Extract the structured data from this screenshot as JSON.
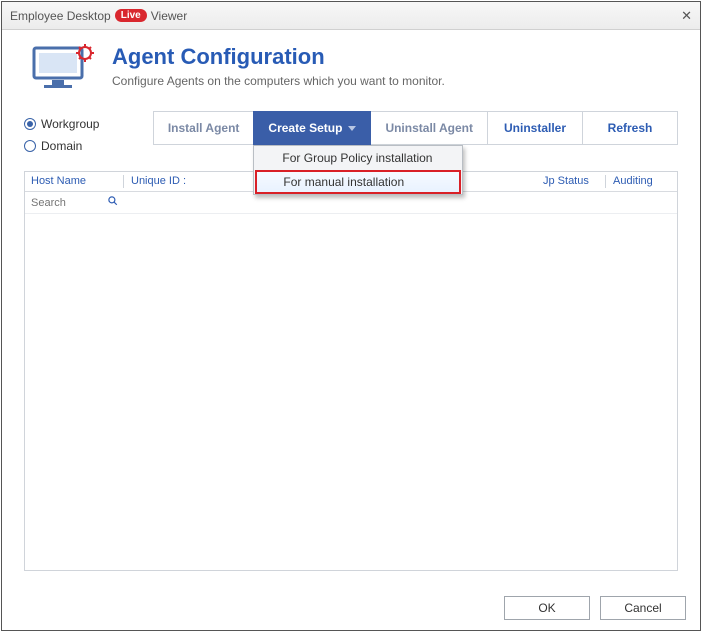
{
  "titlebar": {
    "app": "Employee Desktop",
    "badge": "Live",
    "suffix": "Viewer"
  },
  "header": {
    "title": "Agent Configuration",
    "subtitle": "Configure Agents on the computers which you want to monitor."
  },
  "radios": {
    "workgroup": "Workgroup",
    "domain": "Domain",
    "selected": "workgroup"
  },
  "toolbar": {
    "install": "Install Agent",
    "create": "Create Setup",
    "uninstall_agent": "Uninstall Agent",
    "uninstaller": "Uninstaller",
    "refresh": "Refresh"
  },
  "dropdown": {
    "group_policy": "For Group Policy installation",
    "manual": "For manual installation"
  },
  "grid": {
    "columns": {
      "host": "Host Name",
      "unique": "Unique ID :",
      "status": "Jp Status",
      "auditing": "Auditing"
    },
    "search_placeholder": "Search"
  },
  "footer": {
    "ok": "OK",
    "cancel": "Cancel"
  }
}
